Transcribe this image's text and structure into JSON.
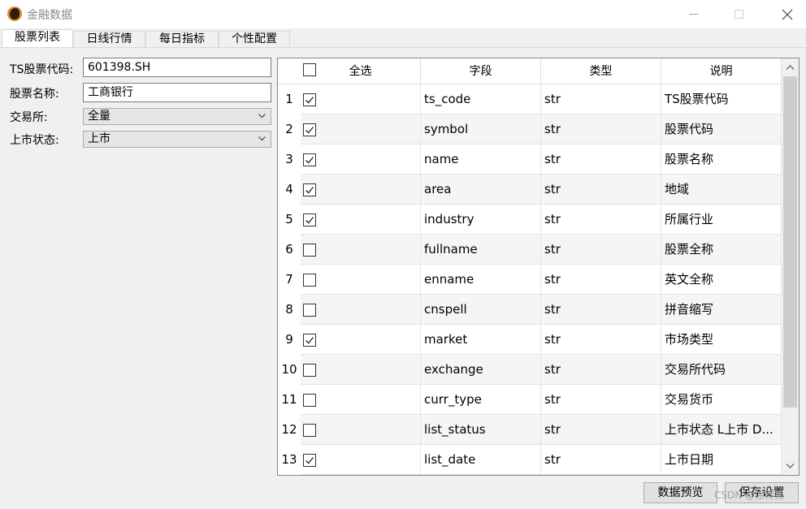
{
  "window": {
    "title": "金融数据"
  },
  "tabs": [
    {
      "label": "股票列表",
      "active": true
    },
    {
      "label": "日线行情",
      "active": false
    },
    {
      "label": "每日指标",
      "active": false
    },
    {
      "label": "个性配置",
      "active": false
    }
  ],
  "form": {
    "ts_code_label": "TS股票代码:",
    "ts_code_value": "601398.SH",
    "name_label": "股票名称:",
    "name_value": "工商银行",
    "exchange_label": "交易所:",
    "exchange_value": "全量",
    "status_label": "上市状态:",
    "status_value": "上市"
  },
  "table": {
    "headers": {
      "select_all": "全选",
      "field": "字段",
      "type": "类型",
      "desc": "说明"
    },
    "rows": [
      {
        "num": "1",
        "checked": true,
        "field": "ts_code",
        "type": "str",
        "desc": "TS股票代码"
      },
      {
        "num": "2",
        "checked": true,
        "field": "symbol",
        "type": "str",
        "desc": "股票代码"
      },
      {
        "num": "3",
        "checked": true,
        "field": "name",
        "type": "str",
        "desc": "股票名称"
      },
      {
        "num": "4",
        "checked": true,
        "field": "area",
        "type": "str",
        "desc": "地域"
      },
      {
        "num": "5",
        "checked": true,
        "field": "industry",
        "type": "str",
        "desc": "所属行业"
      },
      {
        "num": "6",
        "checked": false,
        "field": "fullname",
        "type": "str",
        "desc": "股票全称"
      },
      {
        "num": "7",
        "checked": false,
        "field": "enname",
        "type": "str",
        "desc": "英文全称"
      },
      {
        "num": "8",
        "checked": false,
        "field": "cnspell",
        "type": "str",
        "desc": "拼音缩写"
      },
      {
        "num": "9",
        "checked": true,
        "field": "market",
        "type": "str",
        "desc": "市场类型"
      },
      {
        "num": "10",
        "checked": false,
        "field": "exchange",
        "type": "str",
        "desc": "交易所代码"
      },
      {
        "num": "11",
        "checked": false,
        "field": "curr_type",
        "type": "str",
        "desc": "交易货币"
      },
      {
        "num": "12",
        "checked": false,
        "field": "list_status",
        "type": "str",
        "desc": "上市状态 L上市 D..."
      },
      {
        "num": "13",
        "checked": true,
        "field": "list_date",
        "type": "str",
        "desc": "上市日期"
      }
    ]
  },
  "buttons": {
    "preview": "数据预览",
    "save": "保存设置"
  },
  "watermark": "CSDN @徐博扬"
}
